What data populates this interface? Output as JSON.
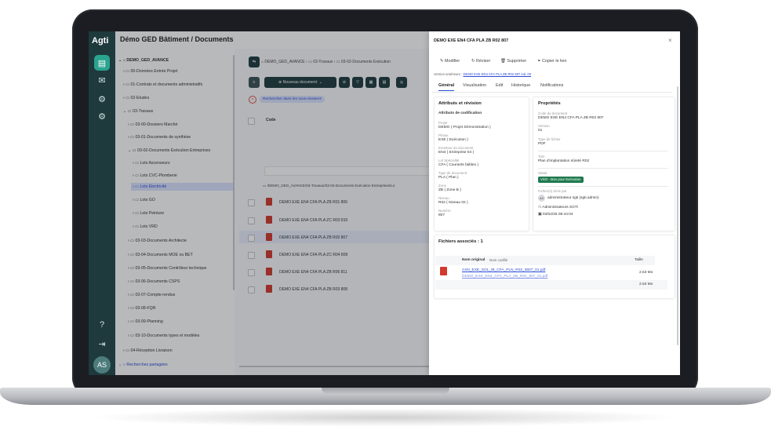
{
  "app": {
    "logo": "Agti",
    "title": "Démo GED Bâtiment / Documents",
    "user_initials": "AS"
  },
  "colors": {
    "rail": "#1e3a3d",
    "accent": "#2aa38f",
    "link": "#2b4bd6",
    "status_green": "#1f7a4f"
  },
  "tree": {
    "root": "DEMO_GED_AVANCE",
    "items": [
      "00-Données Entrée Projet",
      "01-Contrats et documents administratifs",
      "02-Etudes",
      "03-Travaux",
      "03-00-Dossiers Marché",
      "03-01-Documents de synthèse",
      "03-02-Documents Exécution Entreprises",
      "Lots Ascenseurs",
      "Lots CVC-Plomberie",
      "Lots Electricité",
      "Lots GO",
      "Lots Peinture",
      "Lots VRD",
      "03-03-Documents Architecte",
      "03-04-Documents MOE ou BET",
      "03-05-Documents Contrôleur technique",
      "03-06-Documents CSPS",
      "03-07-Compte-rendus",
      "03-08-FQR",
      "03-09-Planning",
      "03-10-Documents types et modèles",
      "04-Réception Livraison"
    ],
    "shared_searches": "Recherches partagées"
  },
  "content": {
    "breadcrumb": [
      "DEMO_GED_AVANCE",
      "03-Travaux",
      "03-02-Documents Exécution"
    ],
    "new_doc_label": "Nouveau document",
    "search_chip": "Rechercher dans les sous-dossiers",
    "code_header": "Code",
    "path_row": "/DEMO_GED_AVANCE/03-Travaux/03-02-Documents Exécution Entreprises/Lo",
    "rows": [
      "DEMO EXE EN4 CFA PLA ZB R01 806",
      "DEMO EXE EN4 CFA PLA ZC R03 810",
      "DEMO EXE EN4 CFA PLA ZB R02 807",
      "DEMO EXE EN4 CFA PLA ZC R04 809",
      "DEMO EXE EN4 CFA PLA ZB R06 811",
      "DEMO EXE EN4 CFA PLA ZB R03 808"
    ]
  },
  "panel": {
    "title": "DEMO EXE EN4 CFA PLA ZB R02 807",
    "close": "×",
    "actions": [
      "Modifier",
      "Réviser",
      "Supprimer",
      "Copier le lien"
    ],
    "previous_label": "Version antérieure :",
    "previous_link": "DEMO EXE EN4 CFA PLA ZB R02 807 ind. 00",
    "tabs": [
      "Général",
      "Visualisation",
      "Edit",
      "Historique",
      "Notifications"
    ],
    "attributes": {
      "title": "Attributs et révision",
      "subtitle": "Attributs de codification",
      "fields": [
        {
          "label": "Projet",
          "value": "DEMO ( Projet Démonstration )"
        },
        {
          "label": "Phase",
          "value": "EXE ( Exécution )"
        },
        {
          "label": "Emetteur du document",
          "value": "EN4 ( Entreprise 04 )"
        },
        {
          "label": "Lot Spécialité",
          "value": "CFA ( Courants faibles )"
        },
        {
          "label": "Type de document",
          "value": "PLA ( Plan )"
        },
        {
          "label": "Zone",
          "value": "ZB ( Zone B )"
        },
        {
          "label": "Niveau",
          "value": "R02 ( Niveau 02 )"
        },
        {
          "label": "Numéro",
          "value": "807"
        }
      ]
    },
    "properties": {
      "title": "Propriétés",
      "code_label": "Code du document",
      "code_value": "DEMO EXE EN4 CFA PLA ZB R02 807",
      "version_label": "Version",
      "version_value": "01",
      "type_label": "Type de fichier",
      "type_value": "PDF",
      "titre_label": "Titre",
      "titre_value": "Plan d'implantation sûreté R02",
      "statut_label": "Statut",
      "statut_value": "VSO - Bon pour Exécution",
      "sender_label": "Fichier(s) émis par",
      "sender_initials": "AS",
      "sender_value": "administrateur sgti (sgti.admin)",
      "group_value": "Administrateurs SGTi",
      "date_value": "03/02/25 09:44:04"
    },
    "files": {
      "title": "Fichiers associés : 1",
      "col_name": "Nom original",
      "col_coded": "Nom codifié",
      "col_size": "Taille",
      "original_name": "AXN_EXE_SOL_IB_CFA_PLN_R02_3807_01.pdf",
      "coded_name": "DEMO_EXE_EN4_CFA_PLA_ZB_R02_807_01.pdf",
      "size": "2.53 Mo",
      "total": "2.53 Mo"
    }
  }
}
